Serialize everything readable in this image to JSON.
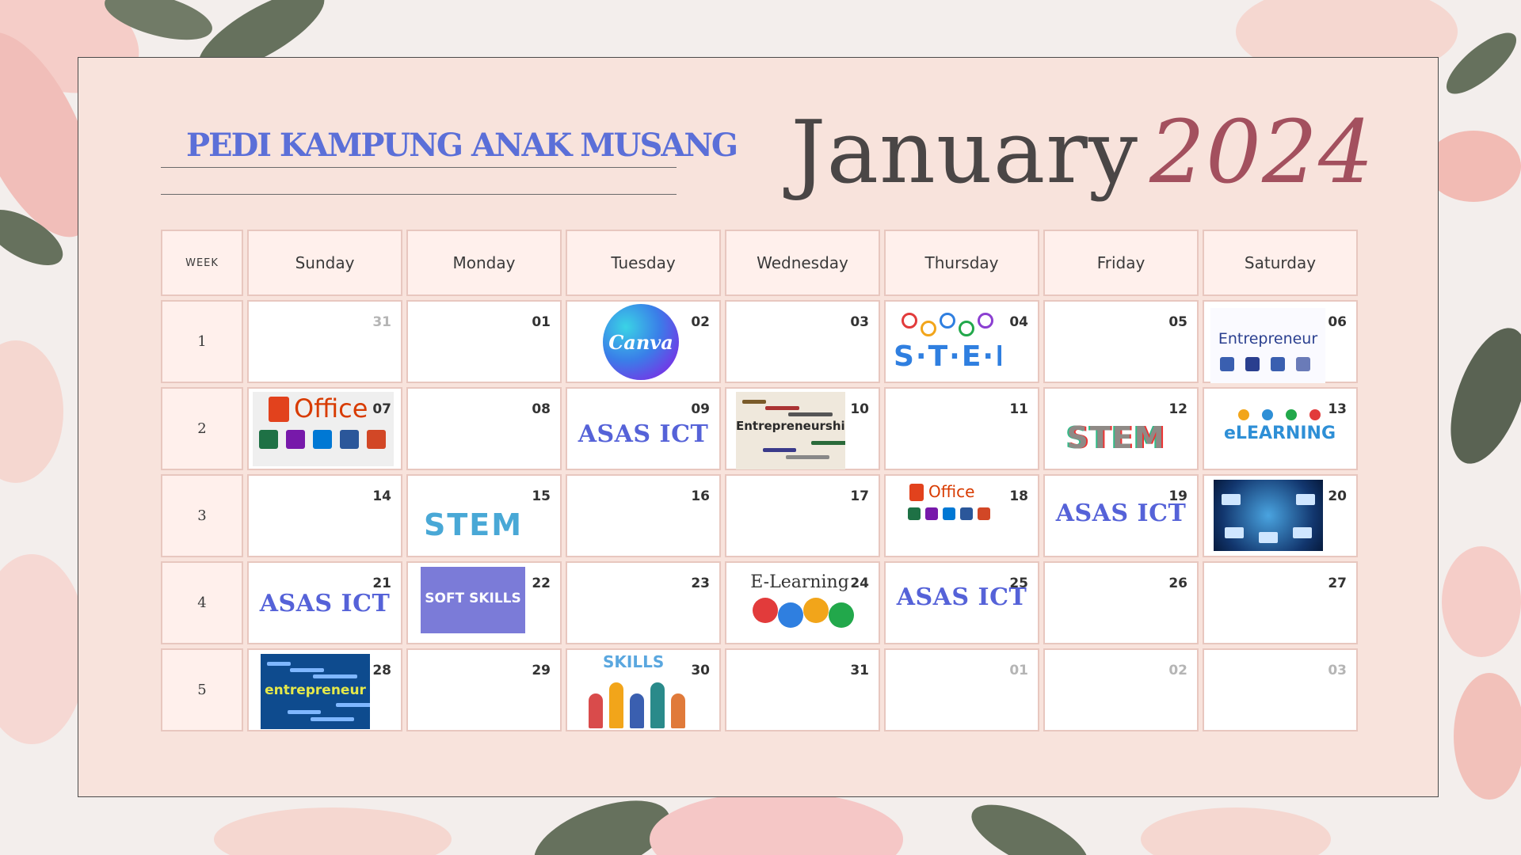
{
  "header": {
    "org_name": "PEDI KAMPUNG ANAK MUSANG",
    "month": "January",
    "year": "2024"
  },
  "calendar": {
    "week_label": "WEEK",
    "days": [
      "Sunday",
      "Monday",
      "Tuesday",
      "Wednesday",
      "Thursday",
      "Friday",
      "Saturday"
    ],
    "weeks": [
      {
        "number": "1",
        "dates": [
          {
            "day": "31",
            "faded": true
          },
          {
            "day": "01"
          },
          {
            "day": "02",
            "image": "canva-logo",
            "image_text": "Canva"
          },
          {
            "day": "03"
          },
          {
            "day": "04",
            "image": "stem-graphic",
            "image_text": "S·T·E·M"
          },
          {
            "day": "05"
          },
          {
            "day": "06",
            "image": "entrepreneur-graphic",
            "image_text": "Entrepreneur"
          }
        ]
      },
      {
        "number": "2",
        "dates": [
          {
            "day": "07",
            "image": "office-suite-graphic",
            "image_text": "Office"
          },
          {
            "day": "08"
          },
          {
            "day": "09",
            "label": "ASAS ICT"
          },
          {
            "day": "10",
            "image": "entrepreneurship-wordcloud",
            "image_text": "Entrepreneurship"
          },
          {
            "day": "11"
          },
          {
            "day": "12",
            "image": "stem-graphic",
            "image_text": "STEM"
          },
          {
            "day": "13",
            "image": "elearning-graphic",
            "image_text": "eLEARNING"
          }
        ]
      },
      {
        "number": "3",
        "dates": [
          {
            "day": "14"
          },
          {
            "day": "15",
            "image": "stem-graphic",
            "image_text": "STEM"
          },
          {
            "day": "16"
          },
          {
            "day": "17"
          },
          {
            "day": "18",
            "image": "office-suite-graphic",
            "image_text": "Office"
          },
          {
            "day": "19",
            "label": "ASAS ICT"
          },
          {
            "day": "20",
            "image": "technology-network-photo"
          }
        ]
      },
      {
        "number": "4",
        "dates": [
          {
            "day": "21",
            "label": "ASAS ICT"
          },
          {
            "day": "22",
            "image": "soft-skills-graphic",
            "image_text": "SOFT SKILLS"
          },
          {
            "day": "23"
          },
          {
            "day": "24",
            "image": "elearning-quiz-graphic",
            "image_text": "E-Learning"
          },
          {
            "day": "25",
            "label": "ASAS ICT"
          },
          {
            "day": "26"
          },
          {
            "day": "27"
          }
        ]
      },
      {
        "number": "5",
        "dates": [
          {
            "day": "28",
            "image": "entrepreneur-wordcloud",
            "image_text": "entrepreneur"
          },
          {
            "day": "29"
          },
          {
            "day": "30",
            "image": "skills-team-illustration",
            "image_text": "SKILLS"
          },
          {
            "day": "31"
          },
          {
            "day": "01",
            "faded": true
          },
          {
            "day": "02",
            "faded": true
          },
          {
            "day": "03",
            "faded": true
          }
        ]
      }
    ]
  },
  "colors": {
    "card_background": "#f8e3dc",
    "title_blue": "#5b6fd8",
    "year_accent": "#a3505e",
    "asas_label": "#5562d8",
    "cell_border": "#e8c7bf"
  }
}
